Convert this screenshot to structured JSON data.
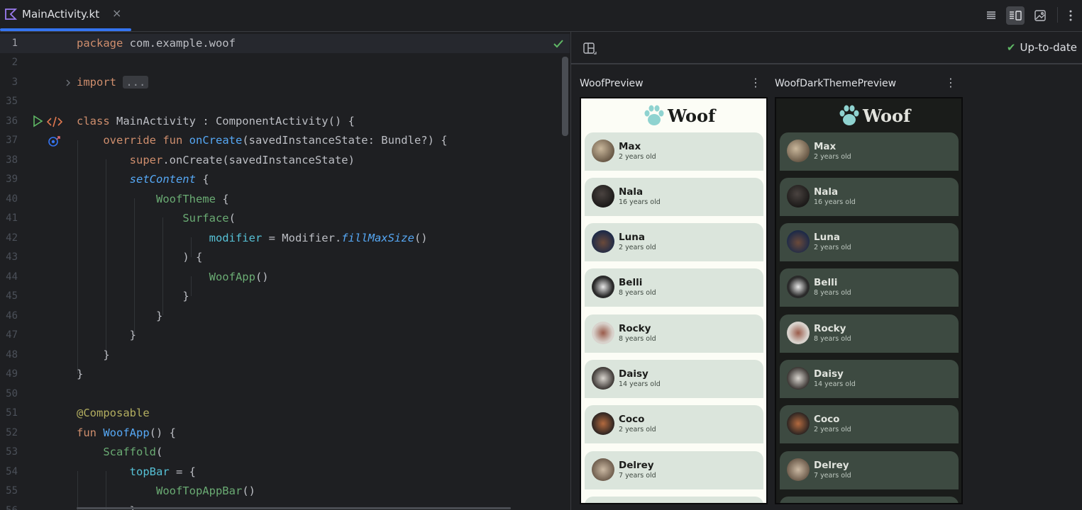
{
  "tab": {
    "title": "MainActivity.kt",
    "close": "×"
  },
  "toolbar": {
    "icons": [
      "code-view-icon",
      "split-view-icon",
      "design-view-icon",
      "more-vertical-icon"
    ]
  },
  "editor": {
    "lines": [
      {
        "n": "1"
      },
      {
        "n": "2"
      },
      {
        "n": "3"
      },
      {
        "n": "35"
      },
      {
        "n": "36"
      },
      {
        "n": "37"
      },
      {
        "n": "38"
      },
      {
        "n": "39"
      },
      {
        "n": "40"
      },
      {
        "n": "41"
      },
      {
        "n": "42"
      },
      {
        "n": "43"
      },
      {
        "n": "44"
      },
      {
        "n": "45"
      },
      {
        "n": "46"
      },
      {
        "n": "47"
      },
      {
        "n": "48"
      },
      {
        "n": "49"
      },
      {
        "n": "50"
      },
      {
        "n": "51"
      },
      {
        "n": "52"
      },
      {
        "n": "53"
      },
      {
        "n": "54"
      },
      {
        "n": "55"
      },
      {
        "n": "56"
      }
    ],
    "code": {
      "l1_kw": "package",
      "l1_rest": " com.example.woof",
      "l3_kw": "import",
      "l3_fold": "...",
      "l36_kw": "class",
      "l36_rest": " MainActivity : ComponentActivity() {",
      "l37_kw": "override fun",
      "l37_fn": "onCreate",
      "l37_rest": "(savedInstanceState: Bundle?) {",
      "l38_kw": "super",
      "l38_rest": ".onCreate(savedInstanceState)",
      "l39_fn": "setContent",
      "l39_rest": " {",
      "l40_cp": "WoofTheme",
      "l40_rest": " {",
      "l41_cp": "Surface",
      "l41_rest": "(",
      "l42_pr": "modifier",
      "l42_mid": " = Modifier.",
      "l42_it": "fillMaxSize",
      "l42_rest": "()",
      "l43": ") {",
      "l44_cp": "WoofApp",
      "l44_rest": "()",
      "l45": "}",
      "l46": "}",
      "l47": "}",
      "l48": "}",
      "l49": "}",
      "l51_an": "@Composable",
      "l52_kw": "fun",
      "l52_fn": "WoofApp",
      "l52_rest": "() {",
      "l53_cp": "Scaffold",
      "l53_rest": "(",
      "l54_pr": "topBar",
      "l54_rest": " = {",
      "l55_cp": "WoofTopAppBar",
      "l55_rest": "()",
      "l56": "}"
    }
  },
  "preview": {
    "status": "Up-to-date",
    "light_label": "WoofPreview",
    "dark_label": "WoofDarkThemePreview",
    "app_title": "Woof",
    "dogs": [
      {
        "name": "Max",
        "age": "2 years old"
      },
      {
        "name": "Nala",
        "age": "16 years old"
      },
      {
        "name": "Luna",
        "age": "2 years old"
      },
      {
        "name": "Belli",
        "age": "8 years old"
      },
      {
        "name": "Rocky",
        "age": "8 years old"
      },
      {
        "name": "Daisy",
        "age": "14 years old"
      },
      {
        "name": "Coco",
        "age": "2 years old"
      },
      {
        "name": "Delrey",
        "age": "7 years old"
      }
    ],
    "colors": {
      "accent": "#3574f0",
      "ok_green": "#5fb865",
      "light_card": "#dbe5dc",
      "dark_card": "#3d4a41"
    }
  }
}
